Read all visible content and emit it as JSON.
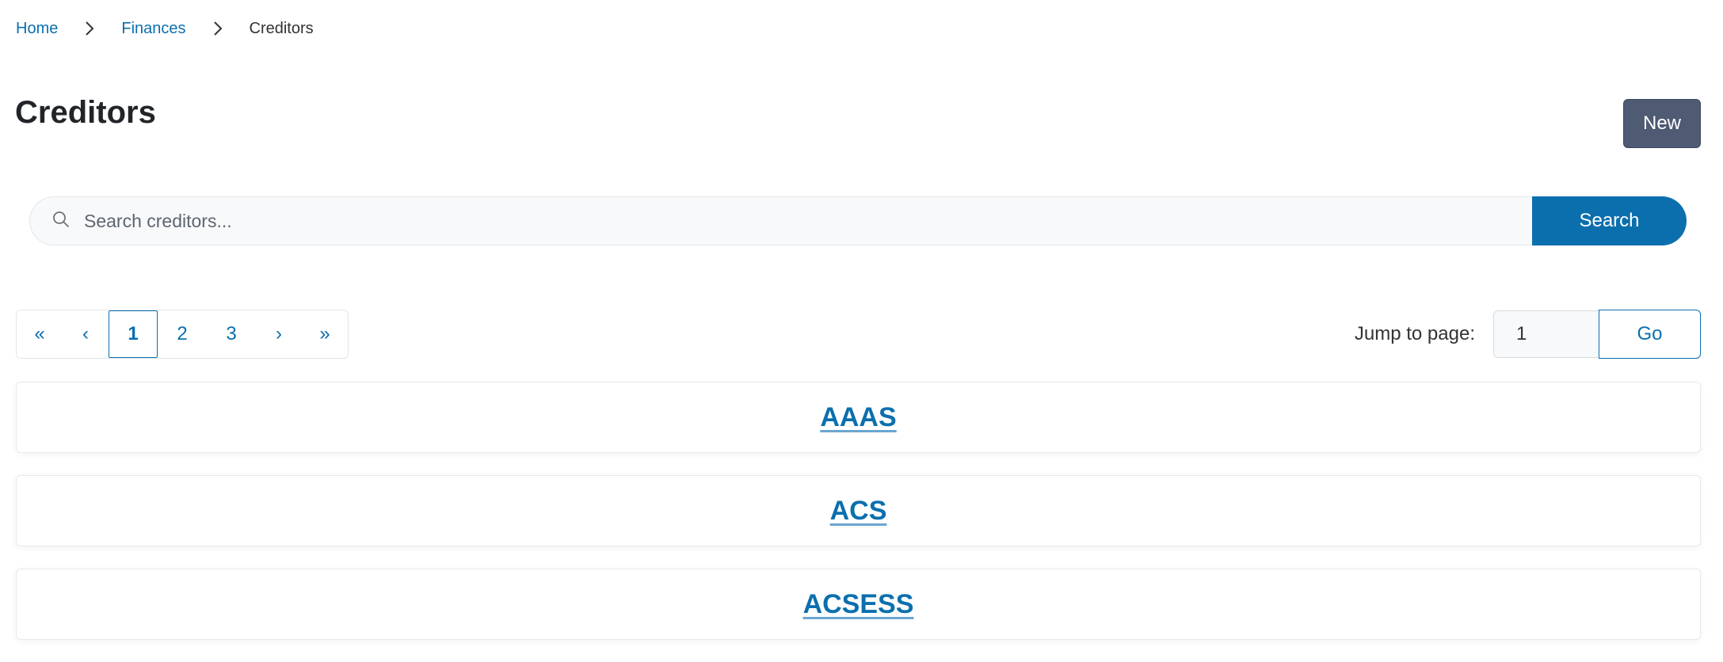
{
  "breadcrumb": {
    "items": [
      "Home",
      "Finances"
    ],
    "current": "Creditors"
  },
  "page": {
    "title": "Creditors",
    "new_button": "New"
  },
  "search": {
    "placeholder": "Search creditors...",
    "value": "",
    "button_label": "Search"
  },
  "pagination": {
    "first": "«",
    "prev": "‹",
    "pages": [
      "1",
      "2",
      "3"
    ],
    "active_page": "1",
    "next": "›",
    "last": "»"
  },
  "jump": {
    "label": "Jump to page:",
    "value": "1",
    "button_label": "Go"
  },
  "creditors": [
    "AAAS",
    "ACS",
    "ACSESS"
  ],
  "colors": {
    "link": "#0b6fae",
    "primary": "#0b6fae",
    "new_button_bg": "#4f5a73"
  },
  "icons": {
    "breadcrumb_separator": "chevron-right-icon",
    "search": "search-icon"
  }
}
